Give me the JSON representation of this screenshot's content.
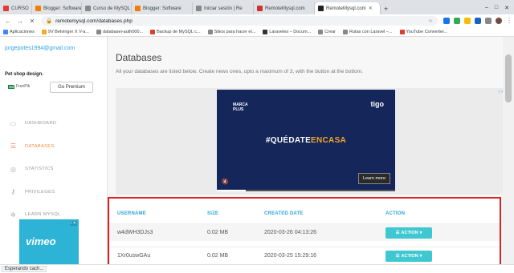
{
  "browser": {
    "tabs": [
      {
        "label": "CURSO",
        "color": "#e53935",
        "active": false
      },
      {
        "label": "Blogger: Software",
        "color": "#f57c00",
        "active": false
      },
      {
        "label": "Curso de MySQL",
        "color": "#888888",
        "active": false
      },
      {
        "label": "Blogger: Software",
        "color": "#f57c00",
        "active": false
      },
      {
        "label": "Iniciar sesión | Re",
        "color": "#888888",
        "active": false
      },
      {
        "label": "RemoteMysql.com",
        "color": "#d32f2f",
        "active": false
      },
      {
        "label": "RemoteMysql.com",
        "color": "#222222",
        "active": true
      }
    ],
    "new_tab": "+",
    "url": "remotemysql.com/databases.php",
    "bookmarks": [
      {
        "label": "Aplicaciones",
        "color": "#4285f4"
      },
      {
        "label": "9V Betvinger X V-a...",
        "color": "#f9a825"
      },
      {
        "label": "databasei-auth000...",
        "color": "#888888"
      },
      {
        "label": "Backup de MySQL c...",
        "color": "#e53935"
      },
      {
        "label": "Sitios para hacer el...",
        "color": "#888888"
      },
      {
        "label": "Laraveles – Docum...",
        "color": "#333333"
      },
      {
        "label": "Crear",
        "color": "#888888"
      },
      {
        "label": "Rutas con Laravel –...",
        "color": "#888888"
      },
      {
        "label": "YouTube Converter...",
        "color": "#e53935"
      }
    ],
    "status": "Esperando cach..."
  },
  "sidebar": {
    "email": "jorgepotes1994@gmail.com",
    "ad": {
      "title": "Pet shop design.",
      "badge": "Ad",
      "price": "FreePik",
      "button": "Go Premium"
    },
    "items": [
      {
        "label": "DASHBOARD",
        "icon": "dashboard-icon",
        "glyph": "▭",
        "active": false
      },
      {
        "label": "DATABASES",
        "icon": "database-icon",
        "glyph": "☰",
        "active": true
      },
      {
        "label": "STATISTICS",
        "icon": "statistics-icon",
        "glyph": "◎",
        "active": false
      },
      {
        "label": "PRIVILEGES",
        "icon": "key-icon",
        "glyph": "⚷",
        "active": false
      },
      {
        "label": "LEARN MYSQL",
        "icon": "gear-icon",
        "glyph": "✲",
        "active": false
      }
    ],
    "vimeo_ad": {
      "logo": "vimeo",
      "adchoice": "i ✕"
    }
  },
  "main": {
    "title": "Databases",
    "description": "All your databases are listed below. Create news ones, upto a maximum of 3, with the button at the bottom.",
    "video_ad": {
      "adtag": "i ✕",
      "marca": "MARCA",
      "marca_sub": "PLUS",
      "brand": "tigo",
      "hashtag_a": "#QUÉDATE",
      "hashtag_b": "ENCASA",
      "learn_more": "Learn more",
      "mute_glyph": "🔇",
      "progress": 0.16
    },
    "table": {
      "columns": [
        "USERNAME",
        "SIZE",
        "CREATED DATE",
        "ACTION"
      ],
      "rows": [
        {
          "username": "w4dWH3DJs3",
          "size": "0.02 MB",
          "created": "2020-03-26 04:13:26",
          "action": "ACTION"
        },
        {
          "username": "1Xr0uswGAu",
          "size": "0.02 MB",
          "created": "2020-03-25 15:29:16",
          "action": "ACTION"
        }
      ]
    }
  },
  "colors": {
    "accent": "#2fa4d9",
    "active_nav": "#f08c4a",
    "action_button": "#3fc7d2",
    "highlight_border": "#e02020"
  }
}
